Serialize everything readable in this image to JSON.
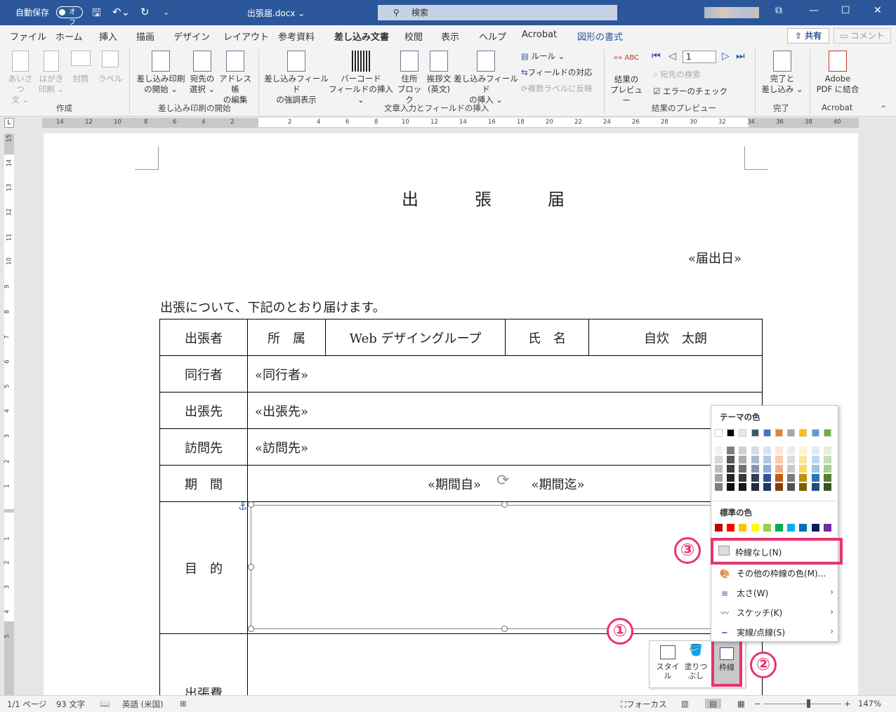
{
  "titlebar": {
    "autosave_label": "自動保存",
    "autosave_state": "オフ",
    "doc_name": "出張届.docx ⌄",
    "search_placeholder": "検索"
  },
  "tabs": [
    "ファイル",
    "ホーム",
    "挿入",
    "描画",
    "デザイン",
    "レイアウト",
    "参考資料",
    "差し込み文書",
    "校閲",
    "表示",
    "ヘルプ",
    "Acrobat",
    "図形の書式"
  ],
  "active_tab": "差し込み文書",
  "share_label": "共有",
  "comment_label": "コメント",
  "ribbon": {
    "create": {
      "group": "作成",
      "buttons": [
        {
          "label": "あいさつ\n文 ⌄",
          "icon": "greeting-icon"
        },
        {
          "label": "はがき\n印刷 ⌄",
          "icon": "postcard-icon"
        },
        {
          "label": "封筒",
          "icon": "envelope-icon"
        },
        {
          "label": "ラベル",
          "icon": "label-icon"
        }
      ]
    },
    "start": {
      "group": "差し込み印刷の開始",
      "buttons": [
        {
          "label": "差し込み印刷\nの開始 ⌄",
          "icon": "start-merge-icon"
        },
        {
          "label": "宛先の\n選択 ⌄",
          "icon": "select-recipients-icon"
        },
        {
          "label": "アドレス帳\nの編集",
          "icon": "edit-list-icon"
        }
      ]
    },
    "fields": {
      "group": "文章入力とフィールドの挿入",
      "buttons": [
        {
          "label": "差し込みフィールド\nの強調表示",
          "icon": "highlight-fields-icon"
        },
        {
          "label": "バーコード\nフィールドの挿入 ⌄",
          "icon": "barcode-icon"
        },
        {
          "label": "住所\nブロック",
          "icon": "address-block-icon"
        },
        {
          "label": "挨拶文\n(英文)",
          "icon": "greeting-line-icon"
        },
        {
          "label": "差し込みフィールド\nの挿入 ⌄",
          "icon": "insert-field-icon"
        }
      ],
      "small": [
        "ルール ⌄",
        "フィールドの対応",
        "複数ラベルに反映"
      ]
    },
    "preview": {
      "group": "結果のプレビュー",
      "button": {
        "label": "結果の\nプレビュー",
        "icon_text": "«» ABC"
      },
      "record": "1",
      "small": [
        "宛先の検索",
        "エラーのチェック"
      ]
    },
    "finish": {
      "group": "完了",
      "button": {
        "label": "完了と\n差し込み ⌄"
      }
    },
    "acrobat": {
      "group": "Acrobat",
      "button": {
        "label": "Adobe\nPDF に結合"
      }
    }
  },
  "ruler": {
    "h_left": [
      "14",
      "12",
      "10",
      "8",
      "6",
      "4",
      "2"
    ],
    "h_right": [
      "2",
      "4",
      "6",
      "8",
      "10",
      "12",
      "14",
      "16",
      "18",
      "20",
      "22",
      "24",
      "26",
      "28",
      "30",
      "32",
      "34",
      "36",
      "38",
      "40"
    ],
    "v_top": [
      "15",
      "14",
      "13",
      "12",
      "11",
      "10",
      "9",
      "8",
      "7",
      "6",
      "5",
      "4",
      "3",
      "2",
      "1"
    ],
    "v_bottom": [
      "1",
      "2",
      "3",
      "4",
      "5"
    ]
  },
  "document": {
    "title": "出　張　届",
    "date_field": "«届出日»",
    "intro": "出張について、下記のとおり届けます。",
    "row1": {
      "label": "出張者",
      "dept_label": "所　属",
      "dept_value": "Web デザイングループ",
      "name_label": "氏　名",
      "name_value": "自炊　太朗"
    },
    "row2": {
      "label": "同行者",
      "value": "«同行者»"
    },
    "row3": {
      "label": "出張先",
      "value": "«出張先»"
    },
    "row4": {
      "label": "訪問先",
      "value": "«訪問先»"
    },
    "row5": {
      "label": "期　間",
      "from": "«期間自»",
      "to": "«期間迄»"
    },
    "row6": {
      "label": "目　的"
    },
    "row7": {
      "label": "出張費"
    }
  },
  "mini_toolbar": {
    "style": "スタイル",
    "fill": "塗りつ\nぶし",
    "border": "枠線"
  },
  "callouts": [
    "①",
    "②",
    "③"
  ],
  "color_menu": {
    "theme_heading": "テーマの色",
    "standard_heading": "標準の色",
    "theme_top": [
      "#ffffff",
      "#000000",
      "#e7e6e6",
      "#44546a",
      "#4472c4",
      "#ed7d31",
      "#a5a5a5",
      "#ffc000",
      "#5b9bd5",
      "#70ad47"
    ],
    "theme_shades": [
      [
        "#f2f2f2",
        "#d8d8d8",
        "#bfbfbf",
        "#a5a5a5",
        "#7f7f7f"
      ],
      [
        "#7f7f7f",
        "#595959",
        "#3f3f3f",
        "#262626",
        "#0d0d0d"
      ],
      [
        "#d0cece",
        "#aeabab",
        "#757171",
        "#3a3838",
        "#171616"
      ],
      [
        "#d6dce4",
        "#adb9ca",
        "#8496b0",
        "#333f4f",
        "#222a35"
      ],
      [
        "#d9e2f3",
        "#b4c6e7",
        "#8eaadb",
        "#2f5496",
        "#1f3864"
      ],
      [
        "#fbe5d5",
        "#f7cbac",
        "#f4b183",
        "#c55a11",
        "#833c0b"
      ],
      [
        "#ededed",
        "#dbdbdb",
        "#c9c9c9",
        "#7b7b7b",
        "#525252"
      ],
      [
        "#fff2cc",
        "#fee599",
        "#ffd965",
        "#bf9000",
        "#7f6000"
      ],
      [
        "#deebf6",
        "#bdd7ee",
        "#9dc3e6",
        "#2e75b5",
        "#1f4e79"
      ],
      [
        "#e2efd9",
        "#c5e0b3",
        "#a8d08d",
        "#538135",
        "#375623"
      ]
    ],
    "standard": [
      "#c00000",
      "#ff0000",
      "#ffc000",
      "#ffff00",
      "#92d050",
      "#00b050",
      "#00b0f0",
      "#0070c0",
      "#002060",
      "#7030a0"
    ],
    "items": [
      {
        "label": "枠線なし(N)",
        "icon": "no-outline-icon"
      },
      {
        "label": "その他の枠線の色(M)...",
        "icon": "palette-icon"
      },
      {
        "label": "太さ(W)",
        "icon": "weight-icon",
        "submenu": true
      },
      {
        "label": "スケッチ(K)",
        "icon": "sketch-icon",
        "submenu": true
      },
      {
        "label": "実線/点線(S)",
        "icon": "dashes-icon",
        "submenu": true
      }
    ]
  },
  "statusbar": {
    "page": "1/1 ページ",
    "words": "93 文字",
    "language": "英語 (米国)",
    "focus": "フォーカス",
    "zoom": "147%",
    "zoom_minus": "−",
    "zoom_plus": "+"
  }
}
